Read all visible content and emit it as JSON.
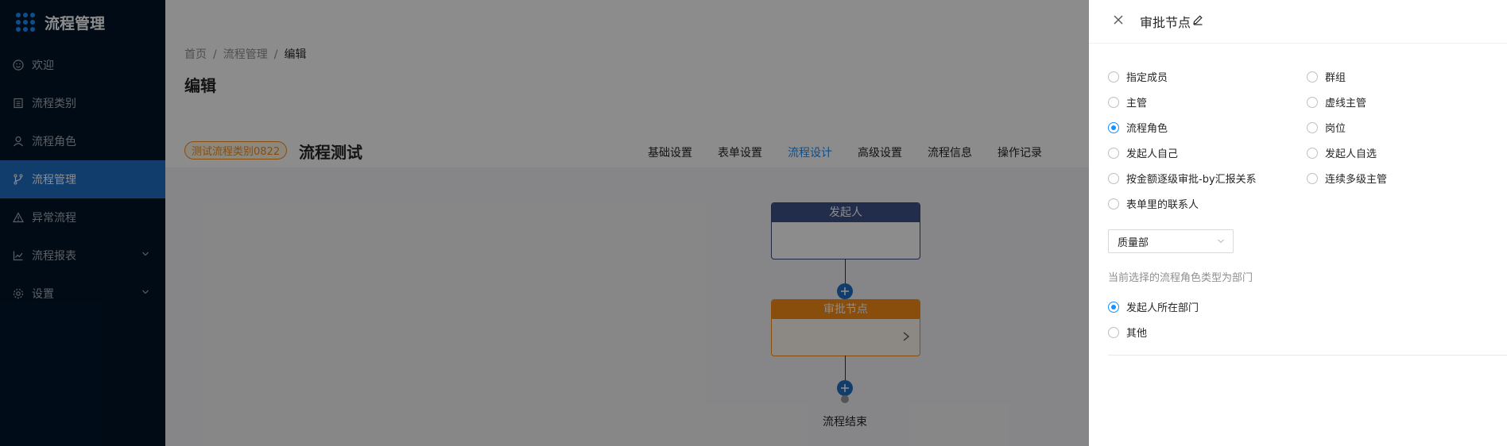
{
  "sidebar": {
    "title": "流程管理",
    "items": [
      {
        "label": "欢迎",
        "icon": "smile-icon"
      },
      {
        "label": "流程类别",
        "icon": "list-icon"
      },
      {
        "label": "流程角色",
        "icon": "user-icon"
      },
      {
        "label": "流程管理",
        "icon": "branch-icon",
        "active": true
      },
      {
        "label": "异常流程",
        "icon": "warning-icon"
      },
      {
        "label": "流程报表",
        "icon": "chart-icon",
        "has_submenu": true
      },
      {
        "label": "设置",
        "icon": "gear-icon",
        "has_submenu": true
      }
    ]
  },
  "breadcrumb": [
    "首页",
    "流程管理",
    "编辑"
  ],
  "page_title": "编辑",
  "flow": {
    "category_tag": "测试流程类别0822",
    "name": "流程测试"
  },
  "tabs": [
    {
      "label": "基础设置"
    },
    {
      "label": "表单设置"
    },
    {
      "label": "流程设计",
      "active": true
    },
    {
      "label": "高级设置"
    },
    {
      "label": "流程信息"
    },
    {
      "label": "操作记录"
    }
  ],
  "designer": {
    "starter_node": "发起人",
    "approval_node": "审批节点",
    "end_label": "流程结束"
  },
  "drawer": {
    "title": "审批节点",
    "approver_options_left": [
      "指定成员",
      "主管",
      "流程角色",
      "发起人自己",
      "按金额逐级审批-by汇报关系",
      "表单里的联系人"
    ],
    "approver_options_right": [
      "群组",
      "虚线主管",
      "岗位",
      "发起人自选",
      "连续多级主管"
    ],
    "selected_approver": "流程角色",
    "role_select_value": "质量部",
    "role_type_hint": "当前选择的流程角色类型为部门",
    "department_options": [
      "发起人所在部门",
      "其他"
    ],
    "selected_department": "发起人所在部门"
  },
  "colors": {
    "sidebar_bg": "#001529",
    "primary": "#1890ff",
    "active_menu": "#1f6fc6",
    "approval_node": "#fa8c16",
    "starter_node": "#3f5189"
  }
}
